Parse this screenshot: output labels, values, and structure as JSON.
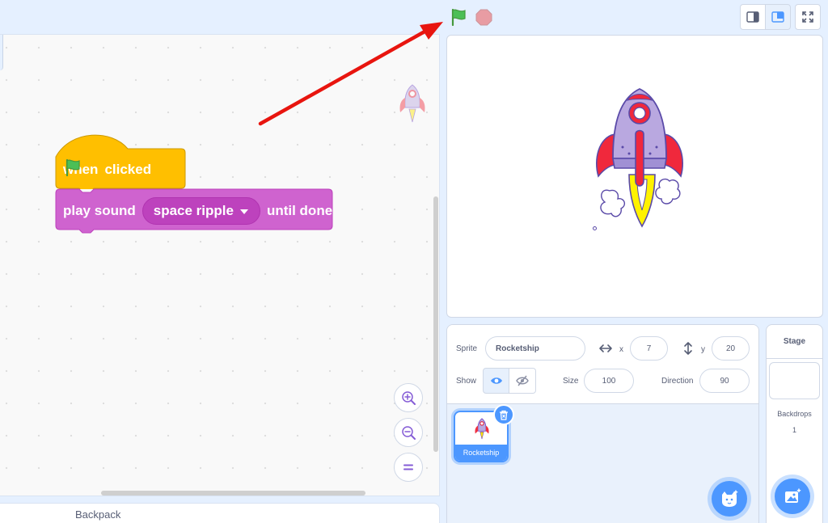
{
  "code_area": {
    "hat_block": {
      "when": "when",
      "clicked": "clicked"
    },
    "sound_block": {
      "label": "play sound",
      "sound": "space ripple",
      "suffix": "until done"
    }
  },
  "backpack": {
    "label": "Backpack"
  },
  "sprite_info": {
    "sprite_label": "Sprite",
    "sprite_name": "Rocketship",
    "x_label": "x",
    "x_value": "7",
    "y_label": "y",
    "y_value": "20",
    "show_label": "Show",
    "size_label": "Size",
    "size_value": "100",
    "direction_label": "Direction",
    "direction_value": "90"
  },
  "sprite_list": [
    {
      "name": "Rocketship"
    }
  ],
  "stage_selector": {
    "title": "Stage",
    "backdrops_label": "Backdrops",
    "backdrops_count": "1"
  },
  "colors": {
    "events": "#ffbf00",
    "sound": "#cf63cf",
    "accent": "#4c97ff",
    "annotation": "#e8150f"
  },
  "icons": [
    "green-flag-icon",
    "stop-icon",
    "small-stage-icon",
    "normal-stage-icon",
    "fullscreen-icon",
    "zoom-in-icon",
    "zoom-out-icon",
    "zoom-reset-icon",
    "eye-icon",
    "eye-slash-icon",
    "trash-icon",
    "add-sprite-icon",
    "add-backdrop-icon"
  ]
}
